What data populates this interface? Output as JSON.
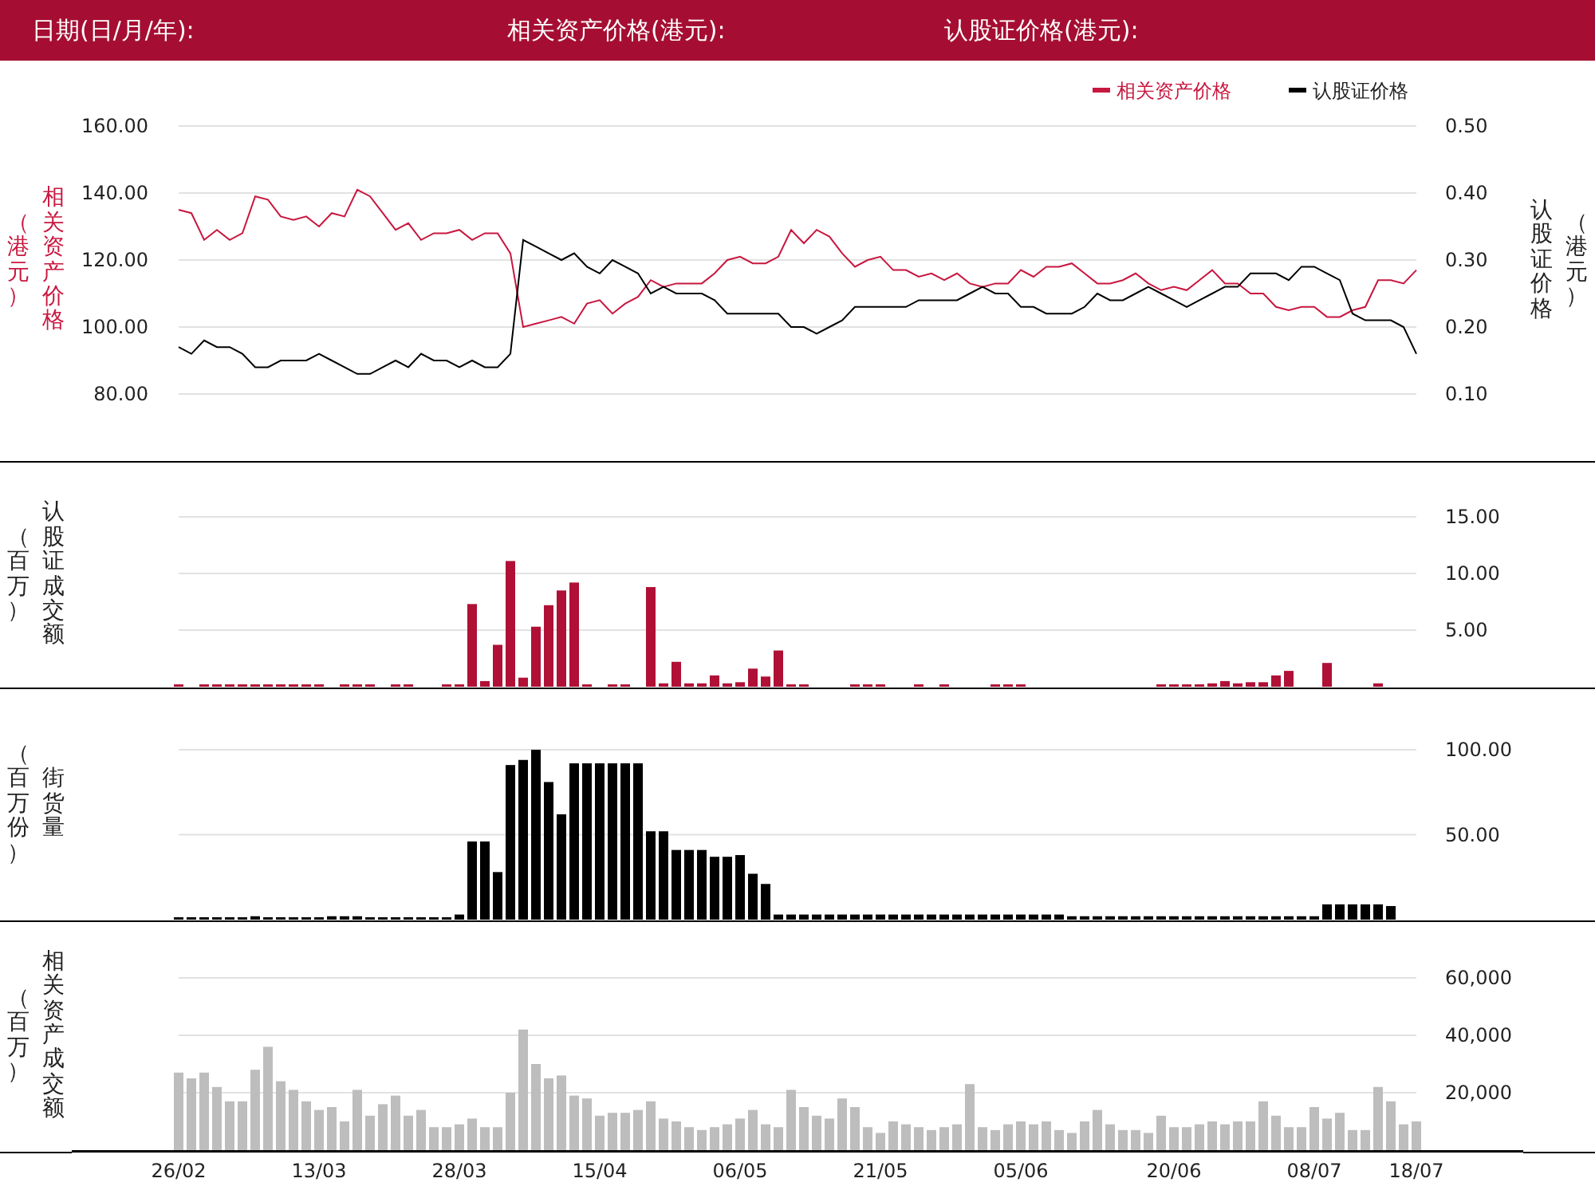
{
  "header": {
    "fields": [
      "日期(日/月/年):",
      "相关资产价格(港元):",
      "认股证价格(港元):"
    ]
  },
  "panels": [
    {
      "ylabel_unit": "（港元）",
      "y2label_unit": "（港元）",
      "chart_data": {
        "type": "line",
        "grid": true,
        "legend": "upper right",
        "ylabel": "相关资产价格",
        "y2label": "认股证价格",
        "ylim": [
          80,
          160
        ],
        "yticks": [
          {
            "value": 80,
            "label": "80.00"
          },
          {
            "value": 100,
            "label": "100.00"
          },
          {
            "value": 120,
            "label": "120.00"
          },
          {
            "value": 140,
            "label": "140.00"
          },
          {
            "value": 160,
            "label": "160.00"
          }
        ],
        "y2lim": [
          0.1,
          0.5
        ],
        "y2ticks": [
          {
            "value": 0.1,
            "label": "0.10"
          },
          {
            "value": 0.2,
            "label": "0.20"
          },
          {
            "value": 0.3,
            "label": "0.30"
          },
          {
            "value": 0.4,
            "label": "0.40"
          },
          {
            "value": 0.5,
            "label": "0.50"
          }
        ],
        "series": [
          {
            "name": "相关资产价格",
            "color": "#c8173f",
            "values": [
              135,
              134,
              126,
              129,
              126,
              128,
              139,
              138,
              133,
              132,
              133,
              130,
              134,
              133,
              141,
              139,
              134,
              129,
              131,
              126,
              128,
              128,
              129,
              126,
              128,
              128,
              122,
              100,
              101,
              102,
              103,
              101,
              107,
              108,
              104,
              107,
              109,
              114,
              112,
              113,
              113,
              113,
              116,
              120,
              121,
              119,
              119,
              121,
              129,
              125,
              129,
              127,
              122,
              118,
              120,
              121,
              117,
              117,
              115,
              116,
              114,
              116,
              113,
              112,
              113,
              113,
              117,
              115,
              118,
              118,
              119,
              116,
              113,
              113,
              114,
              116,
              113,
              111,
              112,
              111,
              114,
              117,
              113,
              113,
              110,
              110,
              106,
              105,
              106,
              106,
              103,
              103,
              105,
              106,
              114,
              114,
              113,
              117
            ]
          },
          {
            "name": "认股证价格",
            "color": "#000000",
            "axis": "y2",
            "values": [
              0.17,
              0.16,
              0.18,
              0.17,
              0.17,
              0.16,
              0.14,
              0.14,
              0.15,
              0.15,
              0.15,
              0.16,
              0.15,
              0.14,
              0.13,
              0.13,
              0.14,
              0.15,
              0.14,
              0.16,
              0.15,
              0.15,
              0.14,
              0.15,
              0.14,
              0.14,
              0.16,
              0.33,
              0.32,
              0.31,
              0.3,
              0.31,
              0.29,
              0.28,
              0.3,
              0.29,
              0.28,
              0.25,
              0.26,
              0.25,
              0.25,
              0.25,
              0.24,
              0.22,
              0.22,
              0.22,
              0.22,
              0.22,
              0.2,
              0.2,
              0.19,
              0.2,
              0.21,
              0.23,
              0.23,
              0.23,
              0.23,
              0.23,
              0.24,
              0.24,
              0.24,
              0.24,
              0.25,
              0.26,
              0.25,
              0.25,
              0.23,
              0.23,
              0.22,
              0.22,
              0.22,
              0.23,
              0.25,
              0.24,
              0.24,
              0.25,
              0.26,
              0.25,
              0.24,
              0.23,
              0.24,
              0.25,
              0.26,
              0.26,
              0.28,
              0.28,
              0.28,
              0.27,
              0.29,
              0.29,
              0.28,
              0.27,
              0.22,
              0.21,
              0.21,
              0.21,
              0.2,
              0.16
            ]
          }
        ]
      }
    },
    {
      "ylabel_unit": "（百万）",
      "chart_data": {
        "type": "bar",
        "ylabel": "认股证成交额",
        "grid": true,
        "ylim": [
          0,
          15
        ],
        "yticks": [
          {
            "value": 5,
            "label": "5.00"
          },
          {
            "value": 10,
            "label": "10.00"
          },
          {
            "value": 15,
            "label": "15.00"
          }
        ],
        "series": [
          {
            "color": "#b01036",
            "values": [
              0.1,
              0,
              0.1,
              0.1,
              0.1,
              0.1,
              0.1,
              0.1,
              0.1,
              0.2,
              0.1,
              0.1,
              0,
              0.2,
              0.2,
              0.1,
              0,
              0.2,
              0.1,
              0,
              0,
              0.1,
              0.2,
              7.3,
              0.5,
              3.7,
              11.1,
              0.8,
              5.3,
              7.2,
              8.5,
              9.2,
              0.1,
              0,
              0.1,
              0.1,
              0,
              8.8,
              0.3,
              2.2,
              0.3,
              0.3,
              1.0,
              0.3,
              0.4,
              1.6,
              0.9,
              3.2,
              0.1,
              0.1,
              0,
              0,
              0,
              0.1,
              0.1,
              0.1,
              0,
              0,
              0.2,
              0,
              0.1,
              0,
              0,
              0,
              0.1,
              0.1,
              0.1,
              0,
              0,
              0,
              0,
              0,
              0,
              0,
              0,
              0,
              0,
              0.1,
              0.1,
              0.2,
              0.2,
              0.3,
              0.5,
              0.3,
              0.4,
              0.4,
              1.0,
              1.4,
              0,
              0,
              2.1,
              0,
              0,
              0,
              0.3,
              0,
              0,
              0
            ]
          }
        ]
      }
    },
    {
      "ylabel_unit": "（百万份）",
      "chart_data": {
        "type": "bar",
        "ylabel": "街货量",
        "grid": true,
        "ylim": [
          0,
          100
        ],
        "yticks": [
          {
            "value": 50,
            "label": "50.00"
          },
          {
            "value": 100,
            "label": "100.00"
          }
        ],
        "series": [
          {
            "color": "#000000",
            "values": [
              1,
              1,
              1,
              1,
              1,
              1,
              2,
              1,
              1,
              1,
              1,
              1,
              2,
              2,
              2,
              1,
              1,
              1,
              1,
              1,
              1,
              1,
              3,
              46,
              46,
              28,
              91,
              94,
              100,
              81,
              62,
              92,
              92,
              92,
              92,
              92,
              92,
              52,
              52,
              41,
              41,
              41,
              37,
              37,
              38,
              27,
              21,
              3,
              3,
              3,
              3,
              3,
              3,
              3,
              3,
              3,
              3,
              3,
              3,
              3,
              3,
              3,
              3,
              3,
              3,
              3,
              3,
              3,
              3,
              3,
              2,
              2,
              2,
              2,
              2,
              2,
              2,
              2,
              2,
              2,
              2,
              2,
              2,
              2,
              2,
              2,
              2,
              2,
              2,
              2,
              9,
              9,
              9,
              9,
              9,
              8,
              null,
              null
            ]
          }
        ]
      }
    },
    {
      "ylabel_unit": "（百万）",
      "chart_data": {
        "type": "bar",
        "ylabel": "相关资产成交额",
        "grid": true,
        "ylim": [
          0,
          60000
        ],
        "yticks": [
          {
            "value": 20000,
            "label": "20,000"
          },
          {
            "value": 40000,
            "label": "40,000"
          },
          {
            "value": 60000,
            "label": "60,000"
          }
        ],
        "categories": [
          "26/02",
          null,
          null,
          null,
          null,
          null,
          null,
          null,
          null,
          null,
          null,
          "13/03",
          null,
          null,
          null,
          null,
          null,
          null,
          null,
          null,
          null,
          null,
          "28/03",
          null,
          null,
          null,
          null,
          null,
          null,
          null,
          null,
          null,
          null,
          "15/04",
          null,
          null,
          null,
          null,
          null,
          null,
          null,
          null,
          null,
          null,
          "06/05",
          null,
          null,
          null,
          null,
          null,
          null,
          null,
          null,
          null,
          null,
          "21/05",
          null,
          null,
          null,
          null,
          null,
          null,
          null,
          null,
          null,
          null,
          "05/06",
          null,
          null,
          null,
          null,
          null,
          null,
          null,
          null,
          null,
          null,
          null,
          "20/06",
          null,
          null,
          null,
          null,
          null,
          null,
          null,
          null,
          null,
          null,
          "08/07",
          null,
          null,
          null,
          null,
          null,
          null,
          null,
          "18/07"
        ],
        "series": [
          {
            "color": "#bdbdbd",
            "values": [
              27000,
              25000,
              27000,
              22000,
              17000,
              17000,
              28000,
              36000,
              24000,
              21000,
              17000,
              14000,
              15000,
              10000,
              21000,
              12000,
              16000,
              19000,
              12000,
              14000,
              8000,
              8000,
              9000,
              11000,
              8000,
              8000,
              20000,
              42000,
              30000,
              25000,
              26000,
              19000,
              18000,
              12000,
              13000,
              13000,
              14000,
              17000,
              11000,
              10000,
              8000,
              7000,
              8000,
              9000,
              11000,
              14000,
              9000,
              8000,
              21000,
              15000,
              12000,
              11000,
              18000,
              15000,
              8000,
              6000,
              10000,
              9000,
              8000,
              7000,
              8000,
              9000,
              23000,
              8000,
              7000,
              9000,
              10000,
              9000,
              10000,
              7000,
              6000,
              10000,
              14000,
              9000,
              7000,
              7000,
              6000,
              12000,
              8000,
              8000,
              9000,
              10000,
              9000,
              10000,
              10000,
              17000,
              12000,
              8000,
              8000,
              15000,
              11000,
              13000,
              7000,
              7000,
              22000,
              17000,
              9000,
              10000
            ]
          }
        ]
      }
    }
  ]
}
